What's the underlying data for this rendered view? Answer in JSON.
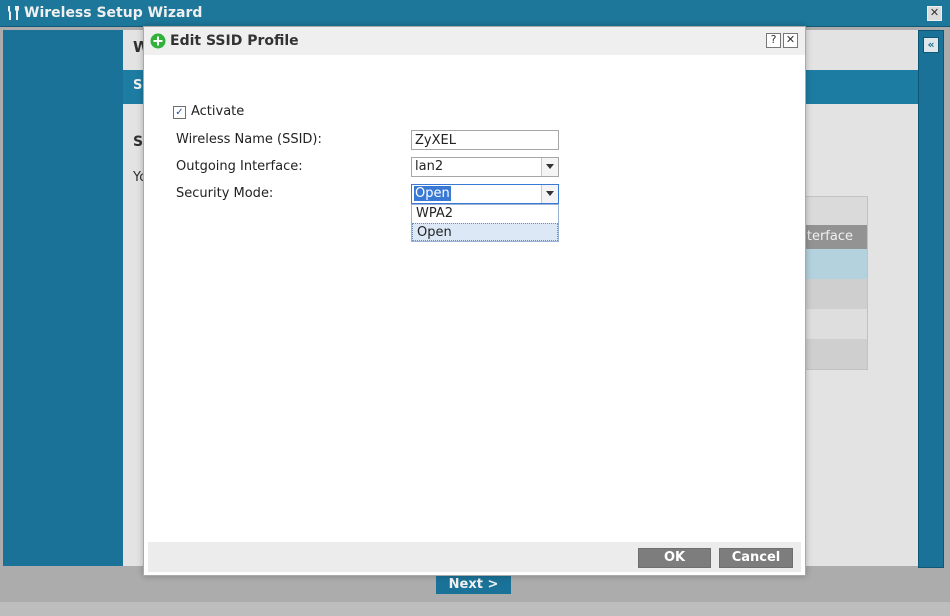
{
  "wizard": {
    "title": "Wireless Setup Wizard",
    "close_glyph": "✕",
    "main_heading": "W",
    "band_text": "S",
    "sub_heading": "S",
    "sub_text": "Yo",
    "table_header": "nterface",
    "collapse_glyph": "«",
    "next_label": "Next >"
  },
  "dialog": {
    "title": "Edit SSID Profile",
    "help_glyph": "?",
    "close_glyph": "✕",
    "activate": {
      "label": "Activate",
      "checked": true
    },
    "ssid": {
      "label": "Wireless Name (SSID):",
      "value": "ZyXEL"
    },
    "outgoing": {
      "label": "Outgoing Interface:",
      "value": "lan2"
    },
    "security": {
      "label": "Security Mode:",
      "value": "Open",
      "options": [
        "WPA2",
        "Open"
      ]
    },
    "ok_label": "OK",
    "cancel_label": "Cancel"
  },
  "colors": {
    "accent": "#1c7aa2",
    "selection": "#3a78d6",
    "button": "#7d7d7d"
  }
}
